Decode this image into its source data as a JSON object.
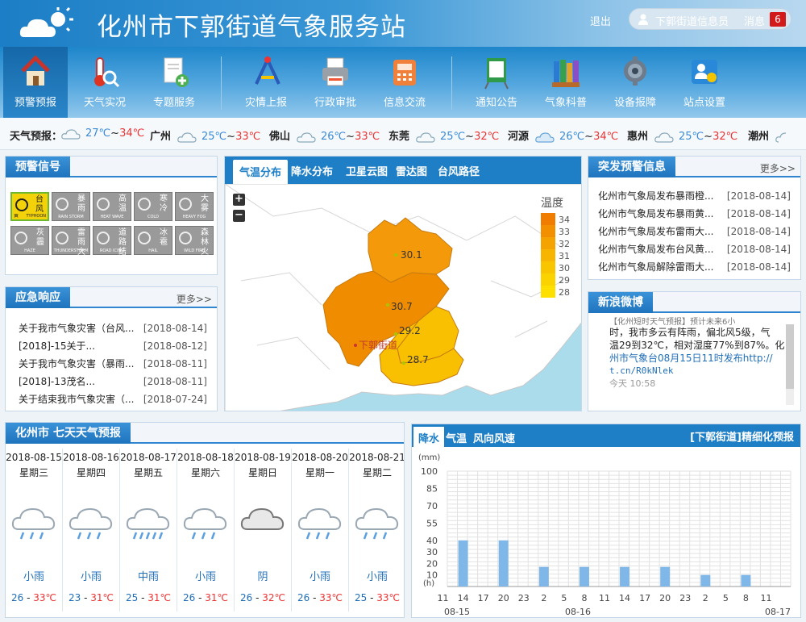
{
  "header": {
    "title": "化州市下郭街道气象服务站",
    "logout": "退出",
    "user": "下郭街道信息员",
    "messages_label": "消息",
    "messages_count": "6"
  },
  "nav": [
    {
      "label": "预警预报",
      "icon": "house-icon"
    },
    {
      "label": "天气实况",
      "icon": "thermometer-icon"
    },
    {
      "label": "专题服务",
      "icon": "document-add-icon"
    },
    {
      "label": "灾情上报",
      "icon": "tools-icon"
    },
    {
      "label": "行政审批",
      "icon": "printer-icon"
    },
    {
      "label": "信息交流",
      "icon": "phone-icon"
    },
    {
      "label": "通知公告",
      "icon": "notice-board-icon"
    },
    {
      "label": "气象科普",
      "icon": "books-icon"
    },
    {
      "label": "设备报障",
      "icon": "gear-icon"
    },
    {
      "label": "站点设置",
      "icon": "user-settings-icon"
    }
  ],
  "weather_bar": {
    "label": "天气预报：",
    "items": [
      {
        "city": "",
        "lo": "27℃",
        "hi": "34℃"
      },
      {
        "city": "广州",
        "lo": "25℃",
        "hi": "33℃"
      },
      {
        "city": "佛山",
        "lo": "26℃",
        "hi": "33℃"
      },
      {
        "city": "东莞",
        "lo": "25℃",
        "hi": "32℃"
      },
      {
        "city": "河源",
        "lo": "26℃",
        "hi": "34℃"
      },
      {
        "city": "惠州",
        "lo": "25℃",
        "hi": "32℃"
      },
      {
        "city": "潮州",
        "lo": "",
        "hi": ""
      }
    ]
  },
  "warning_signals": {
    "title": "预警信号",
    "items": [
      {
        "name": "台风",
        "sub": "TYPHOON",
        "level": "黄",
        "active": true
      },
      {
        "name": "暴雨",
        "sub": "RAIN STORM"
      },
      {
        "name": "高温",
        "sub": "HEAT WAVE"
      },
      {
        "name": "寒冷",
        "sub": "COLD"
      },
      {
        "name": "大雾",
        "sub": "HEAVY FOG"
      },
      {
        "name": "灰霾",
        "sub": "HAZE"
      },
      {
        "name": "雷雨大风",
        "sub": "THUNDERSTORM"
      },
      {
        "name": "道路结冰",
        "sub": "ROAD ICING"
      },
      {
        "name": "冰雹",
        "sub": "HAIL"
      },
      {
        "name": "森林火险",
        "sub": "WILD FIRE"
      }
    ]
  },
  "emergency": {
    "title": "应急响应",
    "more": "更多>>",
    "items": [
      {
        "text": "关于我市气象灾害（台风...",
        "date": "[2018-08-14]"
      },
      {
        "text": "[2018]-15关于...",
        "date": "[2018-08-12]"
      },
      {
        "text": "关于我市气象灾害（暴雨...",
        "date": "[2018-08-11]"
      },
      {
        "text": "[2018]-13茂名...",
        "date": "[2018-08-11]"
      },
      {
        "text": "关于结束我市气象灾害（...",
        "date": "[2018-07-24]"
      }
    ]
  },
  "map": {
    "tabs": [
      "气温分布",
      "降水分布",
      "卫星云图",
      "雷达图",
      "台风路径"
    ],
    "zoom_in": "+",
    "zoom_out": "−",
    "legend_title": "温度",
    "legend": [
      "34",
      "33",
      "32",
      "31",
      "30",
      "29",
      "28"
    ],
    "legend_colors": [
      "#f07c00",
      "#f29000",
      "#f5a300",
      "#f7b400",
      "#f9c400",
      "#fbd400",
      "#fde000"
    ],
    "regions": [
      {
        "value": "30.1"
      },
      {
        "value": "30.7"
      },
      {
        "value": "29.2"
      },
      {
        "value": "28.7"
      }
    ],
    "location": "下郭街道"
  },
  "sudden_warnings": {
    "title": "突发预警信息",
    "more": "更多>>",
    "items": [
      {
        "text": "化州市气象局发布暴雨橙...",
        "date": "[2018-08-14]"
      },
      {
        "text": "化州市气象局发布暴雨黄...",
        "date": "[2018-08-14]"
      },
      {
        "text": "化州市气象局发布雷雨大...",
        "date": "[2018-08-14]"
      },
      {
        "text": "化州市气象局发布台风黄...",
        "date": "[2018-08-14]"
      },
      {
        "text": "化州市气象局解除雷雨大...",
        "date": "[2018-08-14]"
      }
    ]
  },
  "weibo": {
    "title": "新浪微博",
    "top": "【化州短时天气预报】预计未来6小",
    "text1": "时，我市多云有阵雨，偏北风5级，气",
    "text2": "温29到32℃，相对湿度77%到87%。化",
    "text3": "州市气象台08月15日11时发布http://",
    "link": "t.cn/R0kNlek",
    "time": "今天 10:58"
  },
  "forecast7": {
    "title": "化州市 七天天气预报",
    "days": [
      {
        "date": "2018-08-15",
        "week": "星期三",
        "desc": "小雨",
        "lo": "26",
        "hi": "33℃",
        "icon": "light-rain-icon"
      },
      {
        "date": "2018-08-16",
        "week": "星期四",
        "desc": "小雨",
        "lo": "23",
        "hi": "31℃",
        "icon": "light-rain-icon"
      },
      {
        "date": "2018-08-17",
        "week": "星期五",
        "desc": "中雨",
        "lo": "25",
        "hi": "31℃",
        "icon": "moderate-rain-icon"
      },
      {
        "date": "2018-08-18",
        "week": "星期六",
        "desc": "小雨",
        "lo": "26",
        "hi": "31℃",
        "icon": "light-rain-icon"
      },
      {
        "date": "2018-08-19",
        "week": "星期日",
        "desc": "阴",
        "lo": "26",
        "hi": "32℃",
        "icon": "overcast-icon"
      },
      {
        "date": "2018-08-20",
        "week": "星期一",
        "desc": "小雨",
        "lo": "26",
        "hi": "33℃",
        "icon": "light-rain-icon"
      },
      {
        "date": "2018-08-21",
        "week": "星期二",
        "desc": "小雨",
        "lo": "25",
        "hi": "33℃",
        "icon": "light-rain-icon"
      }
    ]
  },
  "fine_forecast": {
    "tabs": [
      "降水",
      "气温",
      "风向风速"
    ],
    "title": "[下郭街道]精细化预报"
  },
  "chart_data": {
    "type": "bar",
    "ylabel": "(mm)",
    "xlabel": "(h)",
    "ylim": [
      0,
      100
    ],
    "yticks": [
      10,
      20,
      30,
      40,
      55,
      70,
      85,
      100
    ],
    "categories": [
      "11",
      "14",
      "17",
      "20",
      "23",
      "2",
      "5",
      "8",
      "11",
      "14",
      "17",
      "20",
      "23",
      "2",
      "5",
      "8",
      "11"
    ],
    "values": [
      0,
      40,
      0,
      40,
      0,
      17,
      0,
      17,
      0,
      17,
      0,
      17,
      0,
      10,
      0,
      10,
      0
    ],
    "dates": [
      "08-15",
      "08-16",
      "08-17"
    ],
    "bar_color": "#7fb7e8",
    "grid": true
  }
}
